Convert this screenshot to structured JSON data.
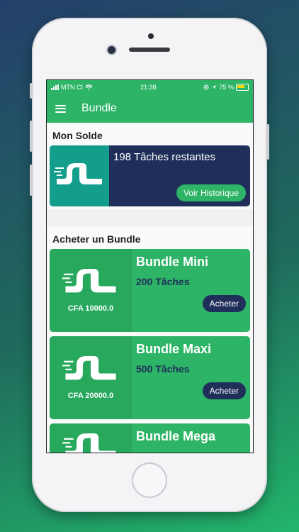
{
  "status_bar": {
    "carrier": "MTN CI",
    "time": "21:38",
    "battery": "75 %"
  },
  "app_bar": {
    "title": "Bundle"
  },
  "balance": {
    "section_title": "Mon Solde",
    "remaining_text": "198 Tâches restantes",
    "history_button": "Voir Historique"
  },
  "bundles": {
    "section_title": "Acheter un Bundle",
    "items": [
      {
        "name": "Bundle Mini",
        "tasks": "200 Tâches",
        "price": "CFA 10000.0",
        "button": "Acheter"
      },
      {
        "name": "Bundle Maxi",
        "tasks": "500 Tâches",
        "price": "CFA 20000.0",
        "button": "Acheter"
      },
      {
        "name": "Bundle Mega",
        "tasks": "",
        "price": "",
        "button": ""
      }
    ]
  },
  "colors": {
    "green": "#2db466",
    "navy": "#1f2f5a",
    "teal": "#139e8c"
  }
}
